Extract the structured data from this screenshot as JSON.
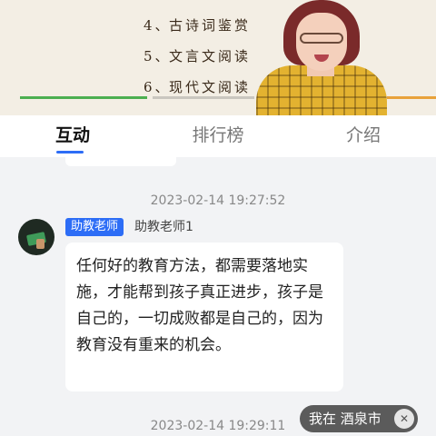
{
  "video": {
    "course_items": [
      {
        "num": "4、",
        "title": "古诗词鉴赏"
      },
      {
        "num": "5、",
        "title": "文言文阅读"
      },
      {
        "num": "6、",
        "title": "现代文阅读"
      }
    ]
  },
  "tabs": [
    {
      "label": "互动",
      "active": true
    },
    {
      "label": "排行榜",
      "active": false
    },
    {
      "label": "介绍",
      "active": false
    }
  ],
  "messages": [
    {
      "timestamp": "2023-02-14 19:27:52",
      "role_badge": "助教老师",
      "sender": "助教老师1",
      "text": "任何好的教育方法，都需要落地实施，才能帮到孩子真正进步，孩子是自己的，一切成败都是自己的，因为教育没有重来的机会。"
    }
  ],
  "next_timestamp": "2023-02-14 19:29:11",
  "location_chip": {
    "label": "我在 酒泉市",
    "close_icon": "close-icon"
  },
  "colors": {
    "accent": "#2d6df6",
    "badge": "#2d6df6"
  }
}
